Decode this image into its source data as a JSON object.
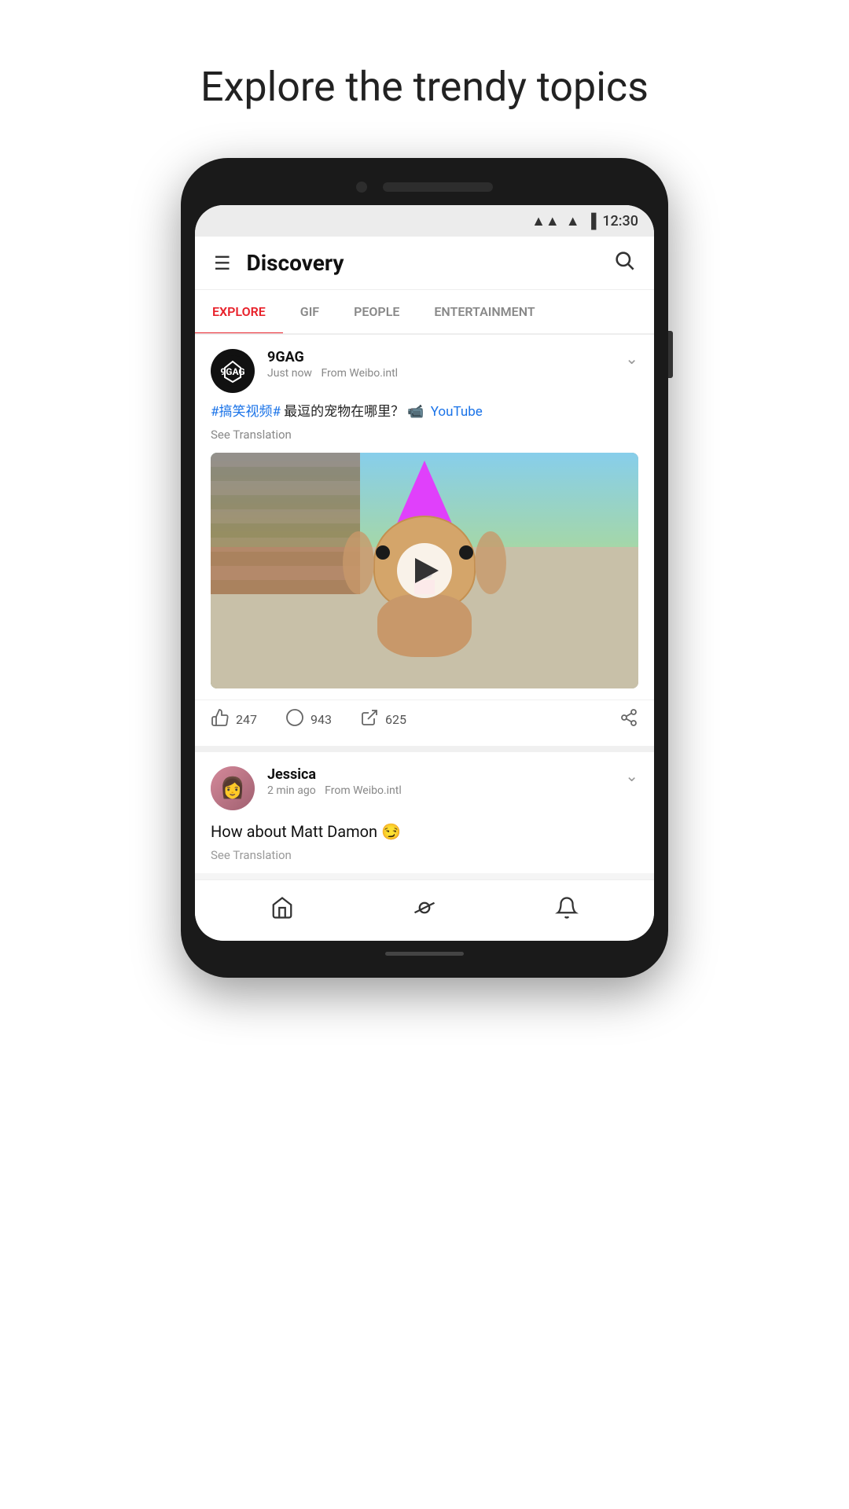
{
  "page": {
    "heading": "Explore the trendy topics"
  },
  "statusBar": {
    "time": "12:30",
    "wifi": "▲",
    "signal": "▲",
    "battery": "🔋"
  },
  "appHeader": {
    "title": "Discovery",
    "hamburger": "≡",
    "searchIcon": "🔍"
  },
  "tabs": [
    {
      "label": "EXPLORE",
      "active": true
    },
    {
      "label": "GIF",
      "active": false
    },
    {
      "label": "PEOPLE",
      "active": false
    },
    {
      "label": "ENTERTAINMENT",
      "active": false
    }
  ],
  "posts": [
    {
      "id": "post1",
      "username": "9GAG",
      "timeAgo": "Just now",
      "source": "From Weibo.intl",
      "bodyHashtag": "#搞笑视频#",
      "bodyText": " 最逗的宠物在哪里？",
      "youtubeText": "YouTube",
      "seeTranslation": "See Translation",
      "likes": "247",
      "comments": "943",
      "shares": "625",
      "hasVideo": true
    },
    {
      "id": "post2",
      "username": "Jessica",
      "timeAgo": "2 min ago",
      "source": "From Weibo.intl",
      "bodyText": "How about Matt Damon 😏",
      "seeTranslation": "See Translation"
    }
  ],
  "bottomNav": {
    "home": "🏠",
    "discover": "🪐",
    "notifications": "🔔"
  },
  "colors": {
    "activeTab": "#e8212a",
    "hashtag": "#1a73e8",
    "youtubeLink": "#1a73e8"
  }
}
